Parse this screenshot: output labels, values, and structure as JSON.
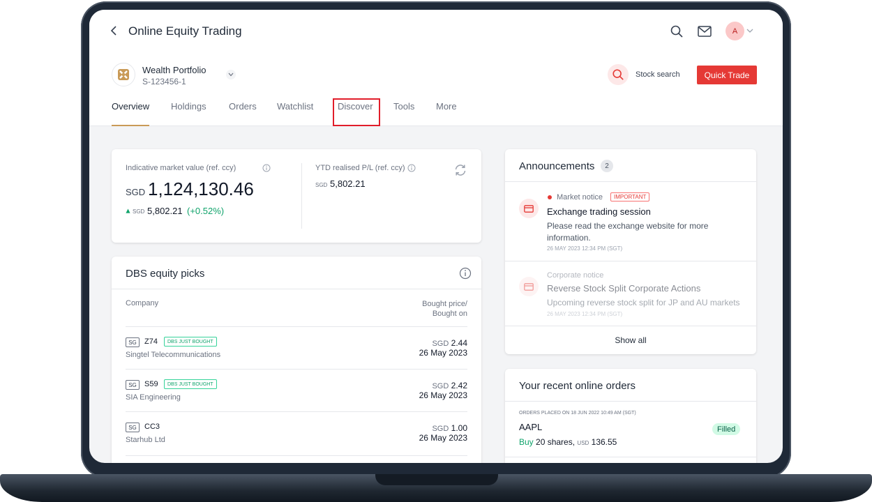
{
  "header": {
    "title": "Online Equity Trading",
    "avatar_initial": "A"
  },
  "portfolio": {
    "name": "Wealth Portfolio",
    "id": "S-123456-1",
    "stock_search_label": "Stock search",
    "quick_trade_label": "Quick Trade"
  },
  "tabs": [
    {
      "label": "Overview",
      "active": true
    },
    {
      "label": "Holdings"
    },
    {
      "label": "Orders"
    },
    {
      "label": "Watchlist"
    },
    {
      "label": "Discover",
      "highlighted": true
    },
    {
      "label": "Tools"
    },
    {
      "label": "More"
    }
  ],
  "market_value": {
    "label": "Indicative market value (ref. ccy)",
    "currency": "SGD",
    "value": "1,124,130.46",
    "change_currency": "SGD",
    "change": "5,802.21",
    "change_pct": "(+0.52%)",
    "ytd_label": "YTD realised P/L (ref. ccy)",
    "ytd_currency": "SGD",
    "ytd_value": "5,802.21"
  },
  "picks": {
    "title": "DBS equity picks",
    "col_company": "Company",
    "col_price_1": "Bought price/",
    "col_price_2": "Bought on",
    "rows": [
      {
        "market": "SG",
        "ticker": "Z74",
        "badge": "DBS JUST BOUGHT",
        "company": "Singtel Telecommunications",
        "currency": "SGD",
        "price": "2.44",
        "date": "26 May 2023"
      },
      {
        "market": "SG",
        "ticker": "S59",
        "badge": "DBS JUST BOUGHT",
        "company": "SIA Engineering",
        "currency": "SGD",
        "price": "2.42",
        "date": "26 May 2023"
      },
      {
        "market": "SG",
        "ticker": "CC3",
        "company": "Starhub Ltd",
        "currency": "SGD",
        "price": "1.00",
        "date": "26 May 2023"
      }
    ]
  },
  "announcements": {
    "title": "Announcements",
    "count": "2",
    "items": [
      {
        "type": "Market notice",
        "tag": "IMPORTANT",
        "heading": "Exchange trading session",
        "body": "Please read the exchange website for more information.",
        "time": "26 MAY 2023 12:34 PM (SGT)"
      },
      {
        "type": "Corporate notice",
        "heading": "Reverse Stock Split Corporate Actions",
        "body": "Upcoming reverse stock split for JP and AU markets",
        "time": "26 MAY 2023 12:34 PM (SGT)"
      }
    ],
    "show_all": "Show all"
  },
  "orders": {
    "title": "Your recent online orders",
    "placed": "ORDERS PLACED ON 18 JUN 2022 10:49 AM (SGT)",
    "symbol": "AAPL",
    "status": "Filled",
    "side": "Buy",
    "shares": "20 shares,",
    "currency": "USD",
    "amount": "136.55"
  },
  "colors": {
    "accent_red": "#e53935",
    "gain_green": "#10a36b",
    "tab_underline": "#c99a56"
  }
}
